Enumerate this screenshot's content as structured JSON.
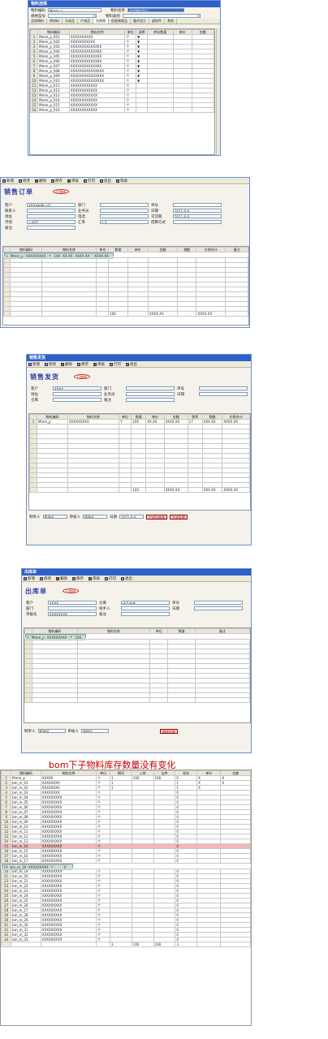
{
  "w1": {
    "title": "物料选择",
    "row1": {
      "label_a": "物料编码",
      "value_a": "Mmm_p",
      "label_b": "物料名称",
      "value_b": "全部物料显示"
    },
    "row2": {
      "label_a": "规格型号",
      "label_b": "物料类别"
    },
    "tabs": [
      "全部物料",
      "原材料",
      "半成品",
      "产成品",
      "包装物",
      "低值易耗品",
      "委外加工",
      "虚拟件",
      "其他"
    ],
    "columns": [
      "",
      "物料编码",
      "物料名称",
      "单位",
      "选择",
      "库存数量",
      "单价",
      "金额"
    ],
    "rows": [
      [
        "1",
        "Mmm_p_001",
        "XXXXXXXXXX",
        "个",
        "▼",
        "",
        "",
        ""
      ],
      [
        "2",
        "Mmm_p_002",
        "XXXXXXXXXXX",
        "个",
        "▼",
        "",
        "",
        ""
      ],
      [
        "3",
        "Mmm_p_003",
        "XXXXXXXXXXXXXX",
        "个",
        "▼",
        "",
        "",
        ""
      ],
      [
        "4",
        "Mmm_p_004",
        "XXXXXXXXXXXXXX",
        "个",
        "▼",
        "",
        "",
        ""
      ],
      [
        "5",
        "Mmm_p_005",
        "XXXXXXXXXXXXXX",
        "个",
        "▼",
        "",
        "",
        ""
      ],
      [
        "6",
        "Mmm_p_006",
        "XXXXXXXXXXXXXX",
        "个",
        "▼",
        "",
        "",
        ""
      ],
      [
        "7",
        "Mmm_p_007",
        "XXXXXXXXXXXXXX",
        "个",
        "▼",
        "",
        "",
        ""
      ],
      [
        "8",
        "Mmm_p_008",
        "XXXXXXXXXXXXXXX",
        "个",
        "▼",
        "",
        "",
        ""
      ],
      [
        "9",
        "Mmm_p_009",
        "XXXXXXXXXXXXXXX",
        "个",
        "▼",
        "",
        "",
        ""
      ],
      [
        "10",
        "Mmm_p_010",
        "XXXXXXXXXXXXXXX",
        "个",
        "▼",
        "",
        "",
        ""
      ],
      [
        "11",
        "Mmm_p_011",
        "XXXXXXXXXXXX",
        "个",
        "",
        "",
        "",
        ""
      ],
      [
        "12",
        "Mmm_p_012",
        "XXXXXXXXXXXX",
        "个",
        "",
        "",
        "",
        ""
      ],
      [
        "13",
        "Mmm_p_013",
        "XXXXXXXXXXXX",
        "个",
        "",
        "",
        "",
        ""
      ],
      [
        "14",
        "Mmm_p_014",
        "XXXXXXXXXXXX",
        "个",
        "",
        "",
        "",
        ""
      ],
      [
        "15",
        "Mmm_p_015",
        "XXXXXXXXXXXX",
        "个",
        "",
        "",
        "",
        ""
      ],
      [
        "16",
        "Mmm_p_016",
        "XXXXXXXXXXXX",
        "个",
        "",
        "",
        "",
        ""
      ]
    ]
  },
  "w2": {
    "toolbar": [
      "新增",
      "修改",
      "删除",
      "保存",
      "审核",
      "打印",
      "退出",
      "帮助"
    ],
    "title": "销售订单",
    "stamp": "已审核",
    "fields": [
      [
        "客户",
        "XXXX有限公司",
        "部门",
        "",
        "单号",
        ""
      ],
      [
        "联系人",
        "",
        "业务员",
        "",
        "日期",
        "2011-0-0"
      ],
      [
        "地址",
        "",
        "电话",
        "",
        "交货期",
        "2011-0-0"
      ],
      [
        "币别",
        "人民币",
        "汇率",
        "1.0",
        "结算方式",
        ""
      ],
      [
        "备注",
        "",
        "",
        "",
        "",
        ""
      ]
    ],
    "columns": [
      "",
      "物料编码",
      "物料名称",
      "单位",
      "数量",
      "单价",
      "金额",
      "税额",
      "价税合计",
      "备注"
    ],
    "rows": [
      [
        "1",
        "Mmm_p",
        "XXXXXXXXX",
        "个",
        "100",
        "XX.XX",
        "XXXX.XX",
        "",
        "XXXX.XX",
        ""
      ]
    ],
    "total": [
      "",
      "",
      "",
      "",
      "100",
      "",
      "XXXX.XX",
      "",
      "XXXX.XX",
      ""
    ]
  },
  "w3": {
    "window_title": "销售发货",
    "toolbar": [
      "新增",
      "修改",
      "删除",
      "保存",
      "审核",
      "打印",
      "退出"
    ],
    "title": "销售发货",
    "stamp": "已审核",
    "fields": [
      [
        "客户",
        "XXXX",
        "部门",
        "",
        "单号",
        ""
      ],
      [
        "地址",
        "",
        "业务员",
        "",
        "日期",
        ""
      ],
      [
        "仓库",
        "",
        "备注",
        "",
        "",
        ""
      ]
    ],
    "columns": [
      "",
      "物料编码",
      "物料名称",
      "单位",
      "数量",
      "单价",
      "金额",
      "税率",
      "税额",
      "价税合计"
    ],
    "rows": [
      [
        "1",
        "Mmm_p",
        "XXXXXXXXX",
        "个",
        "100",
        "XX.XX",
        "XXXX.XX",
        "17",
        "XXX.XX",
        "XXXX.XX"
      ]
    ],
    "total": [
      "",
      "",
      "",
      "",
      "100",
      "",
      "XXXX.XX",
      "",
      "XXX.XX",
      "XXXX.XX"
    ],
    "footer": {
      "maker_label": "制单人",
      "maker": "管理员",
      "reviewer_label": "审核人",
      "reviewer": "管理员",
      "date_label": "日期",
      "date": "2011-0-0",
      "btn1": "生成出库单",
      "btn2": "生成发票"
    }
  },
  "w4": {
    "window_title": "出库单",
    "toolbar": [
      "新增",
      "修改",
      "删除",
      "保存",
      "审核",
      "打印",
      "退出"
    ],
    "title": "出库单",
    "stamp": "已审核",
    "fields": [
      [
        "客户",
        "XXXX",
        "仓库",
        "成品仓库",
        "单号",
        ""
      ],
      [
        "部门",
        "",
        "经手人",
        "",
        "日期",
        ""
      ],
      [
        "单据号",
        "XXXXXXXX",
        "备注",
        "",
        "",
        ""
      ]
    ],
    "columns": [
      "",
      "物料编码",
      "物料名称",
      "单位",
      "数量",
      "备注"
    ],
    "rows": [
      [
        "1",
        "Mmm_p",
        "XXXXXXXXX",
        "个",
        "100",
        ""
      ]
    ],
    "footer": {
      "maker_label": "制单人",
      "maker": "管理员",
      "reviewer_label": "审核人",
      "reviewer": "管理员",
      "btn1": "审核出库"
    }
  },
  "caption": "bom下子物料库存数量没有变化",
  "w5": {
    "columns": [
      "",
      "物料编码",
      "物料名称",
      "单位",
      "期初",
      "入库",
      "出库",
      "结存",
      "单价",
      "金额"
    ],
    "rows": [
      [
        "1",
        "Mmm_p",
        "XXXXX",
        "个",
        "1",
        "100",
        "100",
        "0",
        "X",
        "X"
      ],
      [
        "2",
        "bm_m_01",
        "XXXXXXXX",
        "个",
        "1",
        "",
        "",
        "1",
        "X",
        "X"
      ],
      [
        "3",
        "bm_m_02",
        "XXXXXXXX",
        "个",
        "1",
        "",
        "",
        "1",
        "X",
        ""
      ],
      [
        "4",
        "bm_m_03",
        "XXXXXXXX",
        "个",
        "",
        "",
        "",
        "0",
        "",
        ""
      ],
      [
        "5",
        "bm_m_04",
        "XXXXXXXXX",
        "个",
        "",
        "",
        "",
        "0",
        "",
        ""
      ],
      [
        "6",
        "bm_m_05",
        "XXXXXXXXX",
        "个",
        "",
        "",
        "",
        "0",
        "",
        ""
      ],
      [
        "7",
        "bm_m_06",
        "XXXXXXXXX",
        "个",
        "",
        "",
        "",
        "0",
        "",
        ""
      ],
      [
        "8",
        "bm_m_07",
        "XXXXXXXXX",
        "个",
        "",
        "",
        "",
        "0",
        "",
        ""
      ],
      [
        "9",
        "bm_m_08",
        "XXXXXXXXX",
        "个",
        "",
        "",
        "",
        "0",
        "",
        ""
      ],
      [
        "10",
        "bm_m_09",
        "XXXXXXXXX",
        "个",
        "",
        "",
        "",
        "0",
        "",
        ""
      ],
      [
        "11",
        "bm_m_10",
        "XXXXXXXXX",
        "个",
        "",
        "",
        "",
        "0",
        "",
        ""
      ],
      [
        "12",
        "bm_m_11",
        "XXXXXXXXX",
        "个",
        "",
        "",
        "",
        "0",
        "",
        ""
      ],
      [
        "13",
        "bm_m_12",
        "XXXXXXXXX",
        "个",
        "",
        "",
        "",
        "0",
        "",
        ""
      ],
      [
        "14",
        "bm_m_13",
        "XXXXXXXXX",
        "个",
        "",
        "",
        "",
        "0",
        "",
        ""
      ],
      [
        "15",
        "bm_m_14",
        "XXXXXXXXX",
        "个",
        "",
        "",
        "",
        "0",
        "",
        ""
      ],
      [
        "16",
        "bm_m_15",
        "XXXXXXXXX",
        "个",
        "",
        "",
        "",
        "0",
        "",
        ""
      ],
      [
        "17",
        "bm_m_16",
        "XXXXXXXXX",
        "个",
        "",
        "",
        "",
        "0",
        "",
        ""
      ],
      [
        "18",
        "bm_m_17",
        "XXXXXXXXX",
        "个",
        "",
        "",
        "",
        "0",
        "",
        ""
      ],
      [
        "19",
        "bm_m_18",
        "XXXXXXXXX",
        "个",
        "",
        "",
        "",
        "0",
        "",
        ""
      ],
      [
        "20",
        "bm_m_19",
        "XXXXXXXXX",
        "个",
        "",
        "",
        "",
        "0",
        "",
        ""
      ],
      [
        "21",
        "bm_m_20",
        "XXXXXXXXX",
        "个",
        "",
        "",
        "",
        "0",
        "",
        ""
      ],
      [
        "22",
        "bm_m_21",
        "XXXXXXXXX",
        "个",
        "",
        "",
        "",
        "0",
        "",
        ""
      ],
      [
        "23",
        "bm_m_22",
        "XXXXXXXXX",
        "个",
        "",
        "",
        "",
        "0",
        "",
        ""
      ],
      [
        "24",
        "bm_m_23",
        "XXXXXXXXX",
        "个",
        "",
        "",
        "",
        "0",
        "",
        ""
      ],
      [
        "25",
        "bm_m_24",
        "XXXXXXXXX",
        "个",
        "",
        "",
        "",
        "0",
        "",
        ""
      ],
      [
        "26",
        "bm_m_25",
        "XXXXXXXXX",
        "个",
        "",
        "",
        "",
        "0",
        "",
        ""
      ],
      [
        "27",
        "bm_m_26",
        "XXXXXXXXX",
        "个",
        "",
        "",
        "",
        "0",
        "",
        ""
      ],
      [
        "28",
        "bm_m_27",
        "XXXXXXXXX",
        "个",
        "",
        "",
        "",
        "0",
        "",
        ""
      ],
      [
        "29",
        "bm_m_28",
        "XXXXXXXXX",
        "个",
        "",
        "",
        "",
        "0",
        "",
        ""
      ],
      [
        "30",
        "bm_m_29",
        "XXXXXXXXX",
        "个",
        "",
        "",
        "",
        "0",
        "",
        ""
      ],
      [
        "31",
        "bm_m_30",
        "XXXXXXXXX",
        "个",
        "",
        "",
        "",
        "0",
        "",
        ""
      ],
      [
        "32",
        "bm_m_31",
        "XXXXXXXXX",
        "个",
        "",
        "",
        "",
        "0",
        "",
        ""
      ],
      [
        "33",
        "bm_m_32",
        "XXXXXXXXX",
        "个",
        "",
        "",
        "",
        "0",
        "",
        ""
      ],
      [
        "34",
        "bm_m_33",
        "XXXXXXXXX",
        "个",
        "",
        "",
        "",
        "0",
        "",
        ""
      ]
    ],
    "total": [
      "",
      "",
      "",
      "",
      "3",
      "100",
      "100",
      "3",
      "",
      ""
    ]
  },
  "colors": {
    "titlebar": "#2f5fc8",
    "bill_title": "#2a3fa6",
    "caption": "#c60000",
    "highlight": "#f1b8b8",
    "selected": "#cfe8d6"
  }
}
